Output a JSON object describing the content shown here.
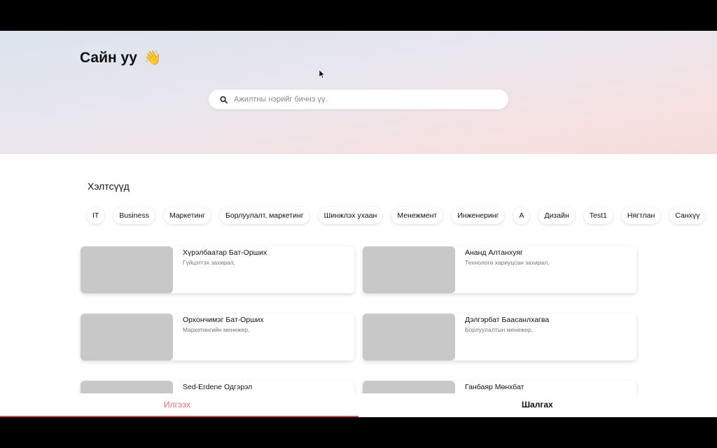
{
  "header": {
    "greeting": "Сайн уу",
    "greeting_emoji": "👋"
  },
  "search": {
    "placeholder": "Ажилтны нэрийг бичнэ үү.",
    "icon": "search-icon"
  },
  "section": {
    "title": "Хэлтсүүд"
  },
  "tags": [
    "IT",
    "Business",
    "Маркетинг",
    "Борлуулалт, маркетинг",
    "Шинжлэх ухаан",
    "Менежмент",
    "Инженеринг",
    "A",
    "Дизайн",
    "Test1",
    "Нягтлан",
    "Санхүү"
  ],
  "employees": [
    {
      "name": "Хүрэлбаатар Бат-Орших",
      "title": "Гүйцэтгэх захирал,"
    },
    {
      "name": "Ананд Алтанхуяг",
      "title": "Технологи хариуцсан захирал,"
    },
    {
      "name": "Орхончимэг Бат-Орших",
      "title": "Маркетингийн менежер,"
    },
    {
      "name": "Дэлгэрбат Баасанлхагва",
      "title": "Борлуулалтын менежер,"
    },
    {
      "name": "Sed-Erdene Одгэрэл",
      "title": ""
    },
    {
      "name": "Ганбаяр Мөнхбат",
      "title": ""
    }
  ],
  "bottom_tabs": {
    "send": "Илгээх",
    "check": "Шалгах"
  },
  "colors": {
    "accent": "#c9534f",
    "placeholder_gray": "#c8c8c8"
  }
}
